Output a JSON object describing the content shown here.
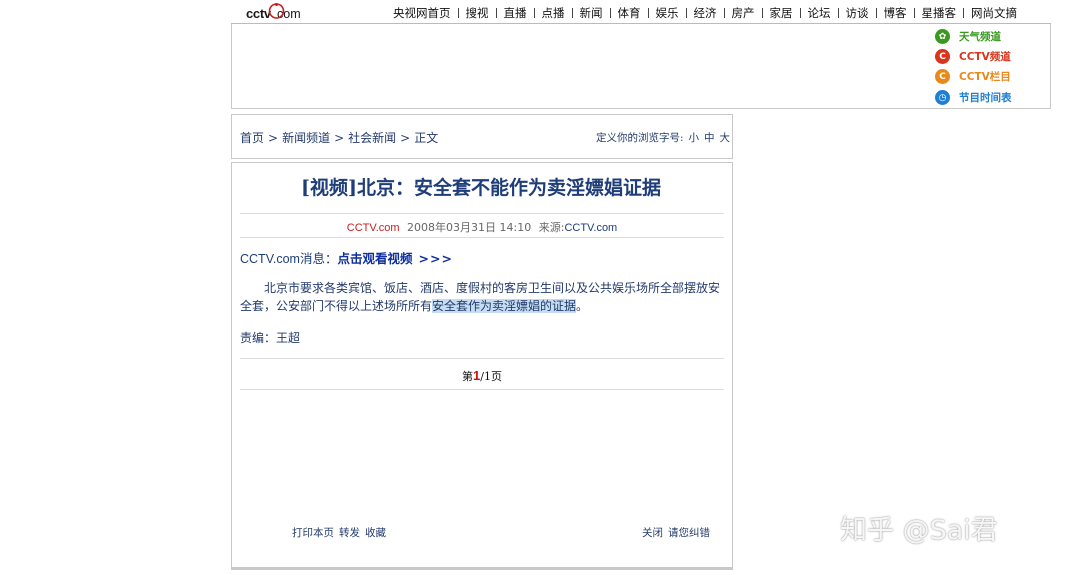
{
  "header": {
    "logo_text": "cctv.com",
    "nav": [
      "央视网首页",
      "搜视",
      "直播",
      "点播",
      "新闻",
      "体育",
      "娱乐",
      "经济",
      "房产",
      "家居",
      "论坛",
      "访谈",
      "博客",
      "星播客",
      "网尚文摘"
    ]
  },
  "quick_links": [
    {
      "label": "天气频道",
      "icon": "weather-icon",
      "color": "#3a9a1f"
    },
    {
      "label": "CCTV频道",
      "icon": "cctv-channel-icon",
      "color": "#d8351c"
    },
    {
      "label": "CCTV栏目",
      "icon": "cctv-column-icon",
      "color": "#e8891c"
    },
    {
      "label": "节目时间表",
      "icon": "schedule-icon",
      "color": "#1f7fd0"
    }
  ],
  "breadcrumb": {
    "items": [
      "首页",
      "新闻频道",
      "社会新闻",
      "正文"
    ],
    "separator": ">"
  },
  "font_size": {
    "label": "定义你的浏览字号:",
    "options": [
      "小",
      "中",
      "大"
    ]
  },
  "article": {
    "title": "[视频]北京：安全套不能作为卖淫嫖娼证据",
    "source_site": "CCTV.com",
    "datetime": "2008年03月31日 14:10",
    "source_label": "来源:",
    "source": "CCTV.com",
    "lead_source": "CCTV.com消息：",
    "lead_click": "点击",
    "lead_watch": "观看视频",
    "lead_arrows": ">>>",
    "body_before": "北京市要求各类宾馆、饭店、酒店、度假村的客房卫生间以及公共娱乐场所全部摆放安全套，公安部门不得以上述场所所有",
    "body_highlight": "安全套作为卖淫嫖娼的证据",
    "body_after": "。",
    "editor": "责编：王超"
  },
  "pager": {
    "prefix": "第",
    "current": "1",
    "middle": "/",
    "total": "1",
    "suffix": "页"
  },
  "footer_tools": {
    "left": [
      "打印本页",
      "转发",
      "收藏"
    ],
    "right": [
      "关闭",
      "请您纠错"
    ]
  },
  "watermark": "知乎 @Sai君"
}
